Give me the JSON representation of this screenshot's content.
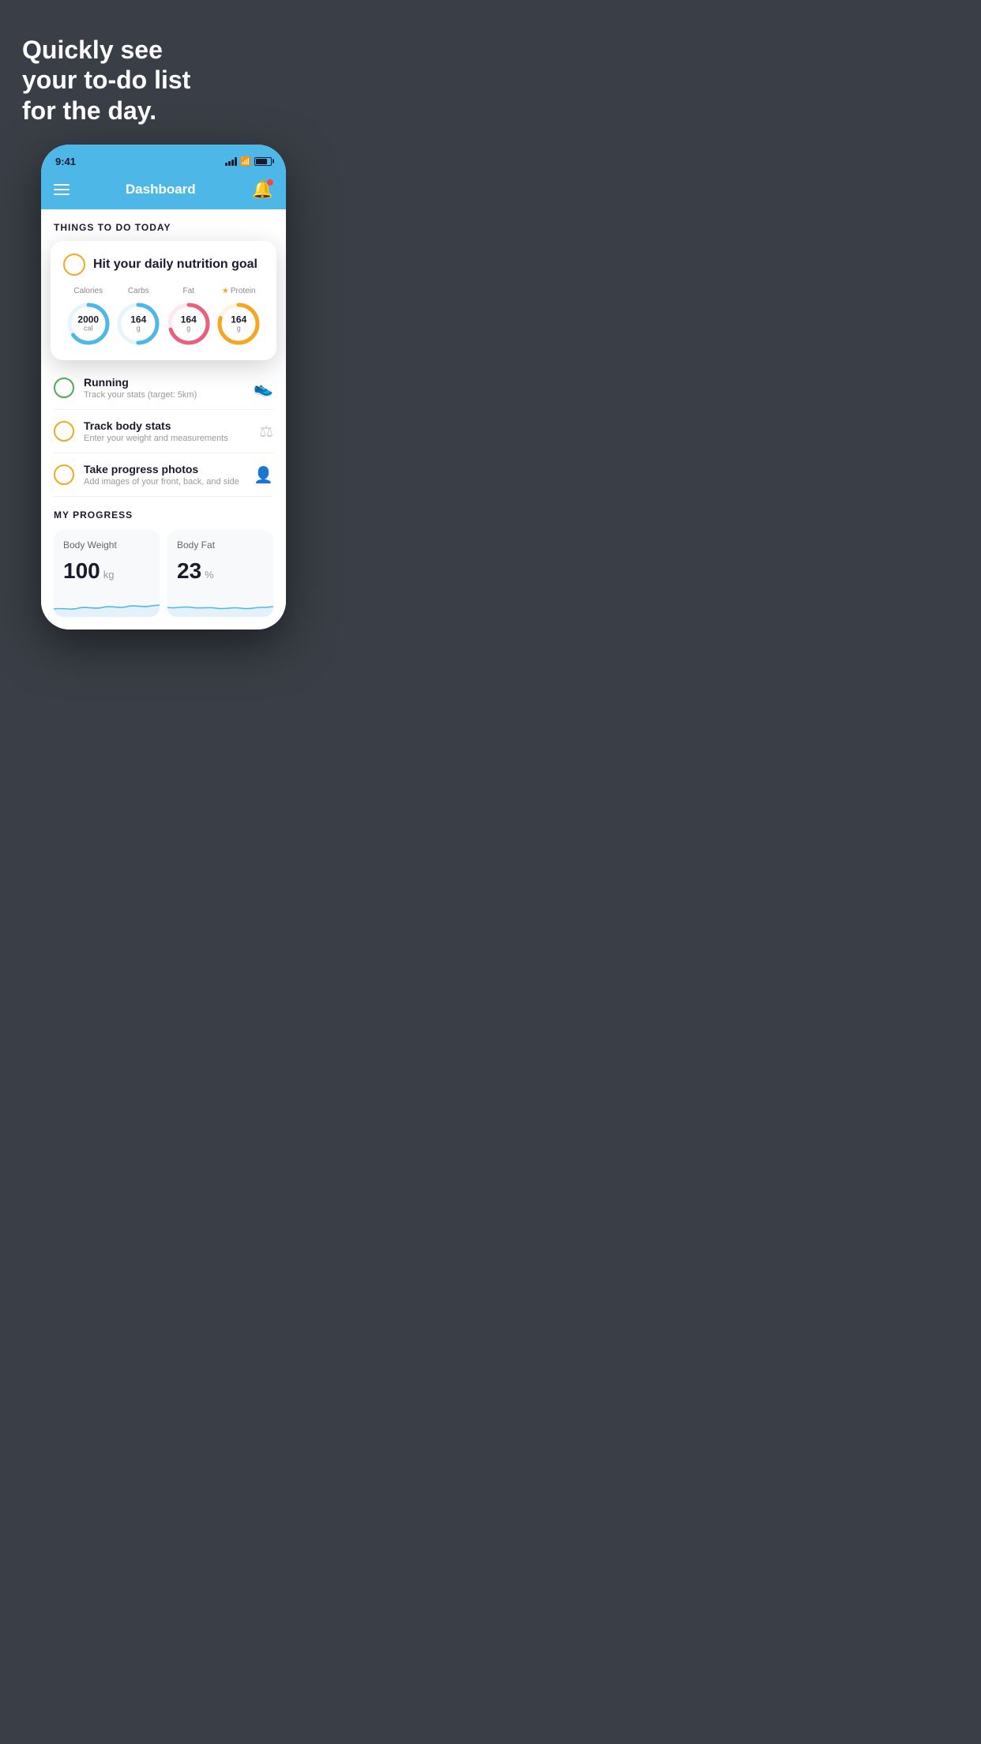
{
  "hero": {
    "title": "Quickly see\nyour to-do list\nfor the day."
  },
  "status_bar": {
    "time": "9:41"
  },
  "nav": {
    "title": "Dashboard"
  },
  "things_section": {
    "title": "THINGS TO DO TODAY"
  },
  "nutrition_card": {
    "title": "Hit your daily nutrition goal",
    "items": [
      {
        "label": "Calories",
        "value": "2000",
        "unit": "cal",
        "color": "#4db8e8",
        "pct": 65
      },
      {
        "label": "Carbs",
        "value": "164",
        "unit": "g",
        "color": "#4db8e8",
        "pct": 50
      },
      {
        "label": "Fat",
        "value": "164",
        "unit": "g",
        "color": "#e8607a",
        "pct": 70
      },
      {
        "label": "Protein",
        "value": "164",
        "unit": "g",
        "color": "#f5a623",
        "pct": 80,
        "starred": true
      }
    ]
  },
  "todo_items": [
    {
      "name": "Running",
      "desc": "Track your stats (target: 5km)",
      "circle_color": "green",
      "icon": "👟"
    },
    {
      "name": "Track body stats",
      "desc": "Enter your weight and measurements",
      "circle_color": "orange",
      "icon": "⚖"
    },
    {
      "name": "Take progress photos",
      "desc": "Add images of your front, back, and side",
      "circle_color": "orange",
      "icon": "👤"
    }
  ],
  "progress_section": {
    "title": "MY PROGRESS",
    "cards": [
      {
        "title": "Body Weight",
        "value": "100",
        "unit": "kg"
      },
      {
        "title": "Body Fat",
        "value": "23",
        "unit": "%"
      }
    ]
  }
}
